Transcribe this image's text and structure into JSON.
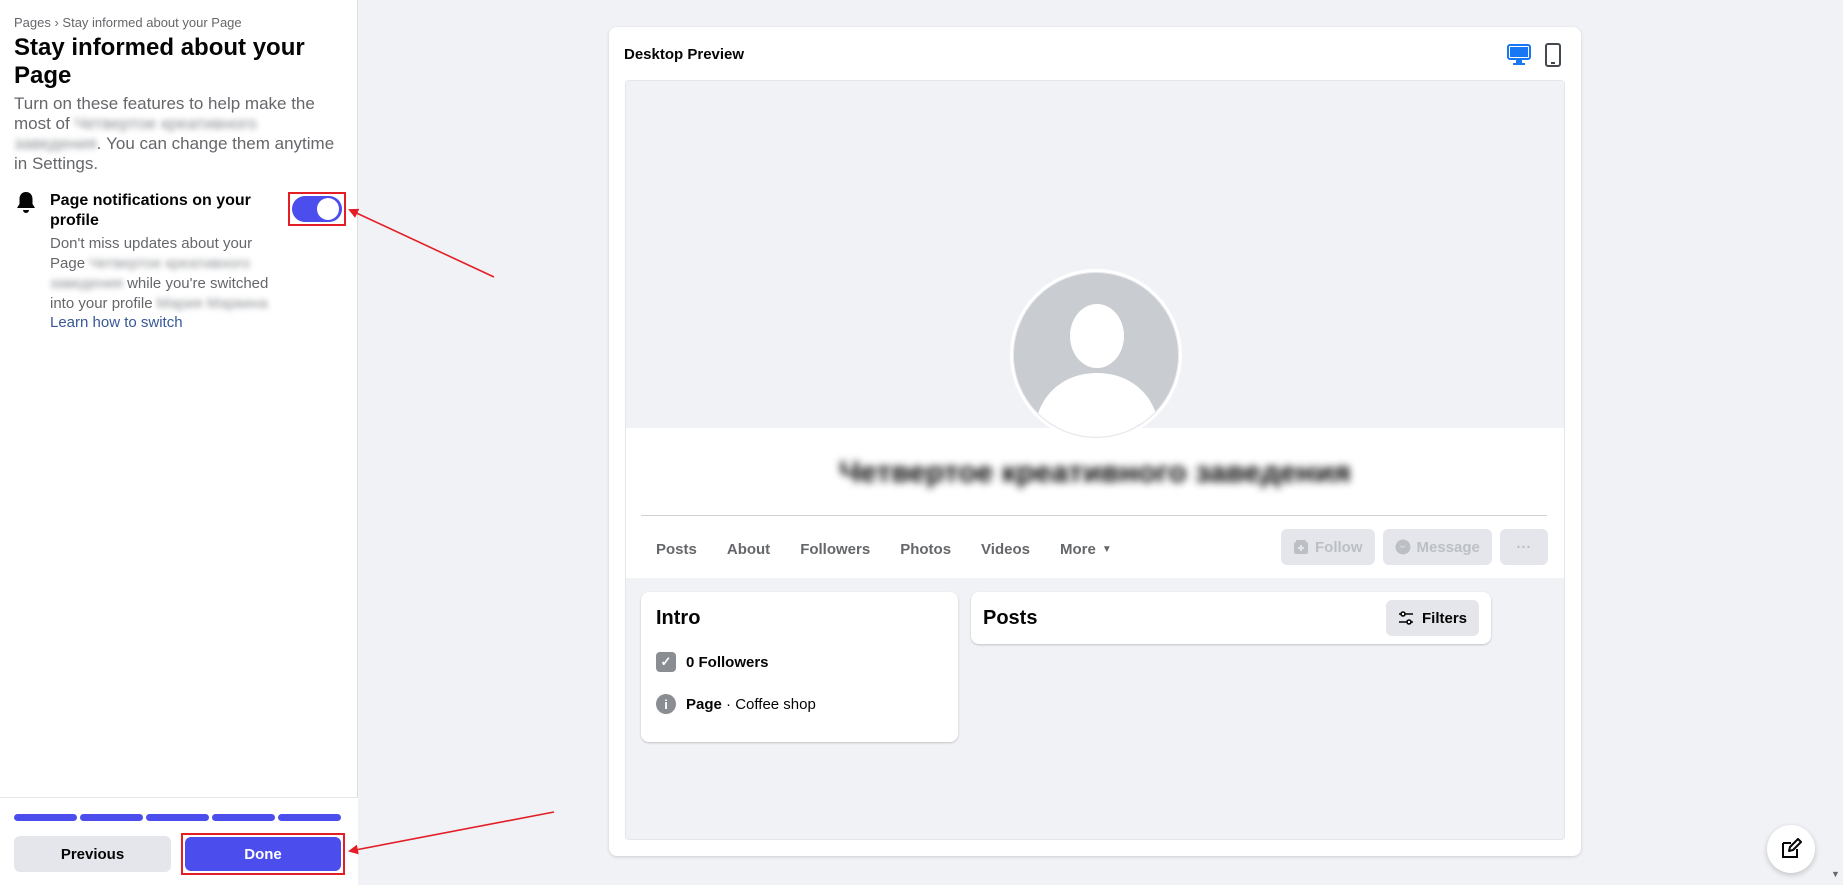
{
  "sidebar": {
    "breadcrumb": "Pages › Stay informed about your Page",
    "title": "Stay informed about your Page",
    "intro_pre": "Turn on these features to help make the most of",
    "intro_blurred": "Четвертое креативного заведения",
    "intro_post": ". You can change them anytime in Settings.",
    "feature": {
      "icon": "bell-icon",
      "title": "Page notifications on your profile",
      "desc_1": "Don't miss updates about your Page",
      "desc_blurred_1": "Четвертое креативного заведения",
      "desc_2": "while you're switched into your profile",
      "desc_blurred_2": "Мария Маркина",
      "link": "Learn how to switch",
      "toggle_on": true
    },
    "progress_steps": 5,
    "previous_label": "Previous",
    "done_label": "Done"
  },
  "preview": {
    "title": "Desktop Preview",
    "page_name": "Четвертое креативного заведения",
    "tabs": [
      "Posts",
      "About",
      "Followers",
      "Photos",
      "Videos",
      "More"
    ],
    "actions": {
      "follow": "Follow",
      "message": "Message",
      "more": "···"
    },
    "intro": {
      "title": "Intro",
      "followers": "0 Followers",
      "page_label": "Page",
      "page_sep": " · ",
      "category": "Coffee shop"
    },
    "posts": {
      "title": "Posts",
      "filters_label": "Filters"
    }
  },
  "colors": {
    "accent": "#4b4ded",
    "annotation": "#e41e26",
    "desktop_icon": "#1877f2"
  }
}
